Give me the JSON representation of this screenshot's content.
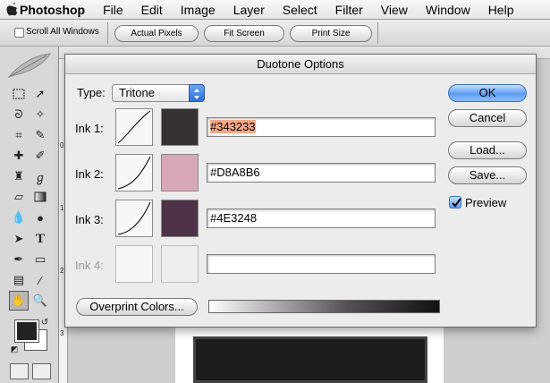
{
  "menubar": {
    "app_name": "Photoshop",
    "items": [
      "File",
      "Edit",
      "Image",
      "Layer",
      "Select",
      "Filter",
      "View",
      "Window",
      "Help"
    ]
  },
  "options_bar": {
    "scroll_all_windows": "Scroll All Windows",
    "actual_pixels": "Actual Pixels",
    "fit_screen": "Fit Screen",
    "print_size": "Print Size"
  },
  "ruler": {
    "marks": [
      "0",
      "1",
      "2",
      "3"
    ]
  },
  "dialog": {
    "title": "Duotone Options",
    "type_label": "Type:",
    "type_value": "Tritone",
    "inks": [
      {
        "label": "Ink 1:",
        "hex": "#343233",
        "color": "#343233",
        "enabled": true
      },
      {
        "label": "Ink 2:",
        "hex": "#D8A8B6",
        "color": "#D8A8B6",
        "enabled": true
      },
      {
        "label": "Ink 3:",
        "hex": "#4E3248",
        "color": "#4E3248",
        "enabled": true
      },
      {
        "label": "Ink 4:",
        "hex": "",
        "color": "",
        "enabled": false
      }
    ],
    "buttons": {
      "ok": "OK",
      "cancel": "Cancel",
      "load": "Load...",
      "save": "Save..."
    },
    "preview_label": "Preview",
    "preview_checked": true,
    "overprint_label": "Overprint Colors..."
  },
  "colors": {
    "accent": "#5d9cf2",
    "selection": "#f7a889"
  }
}
